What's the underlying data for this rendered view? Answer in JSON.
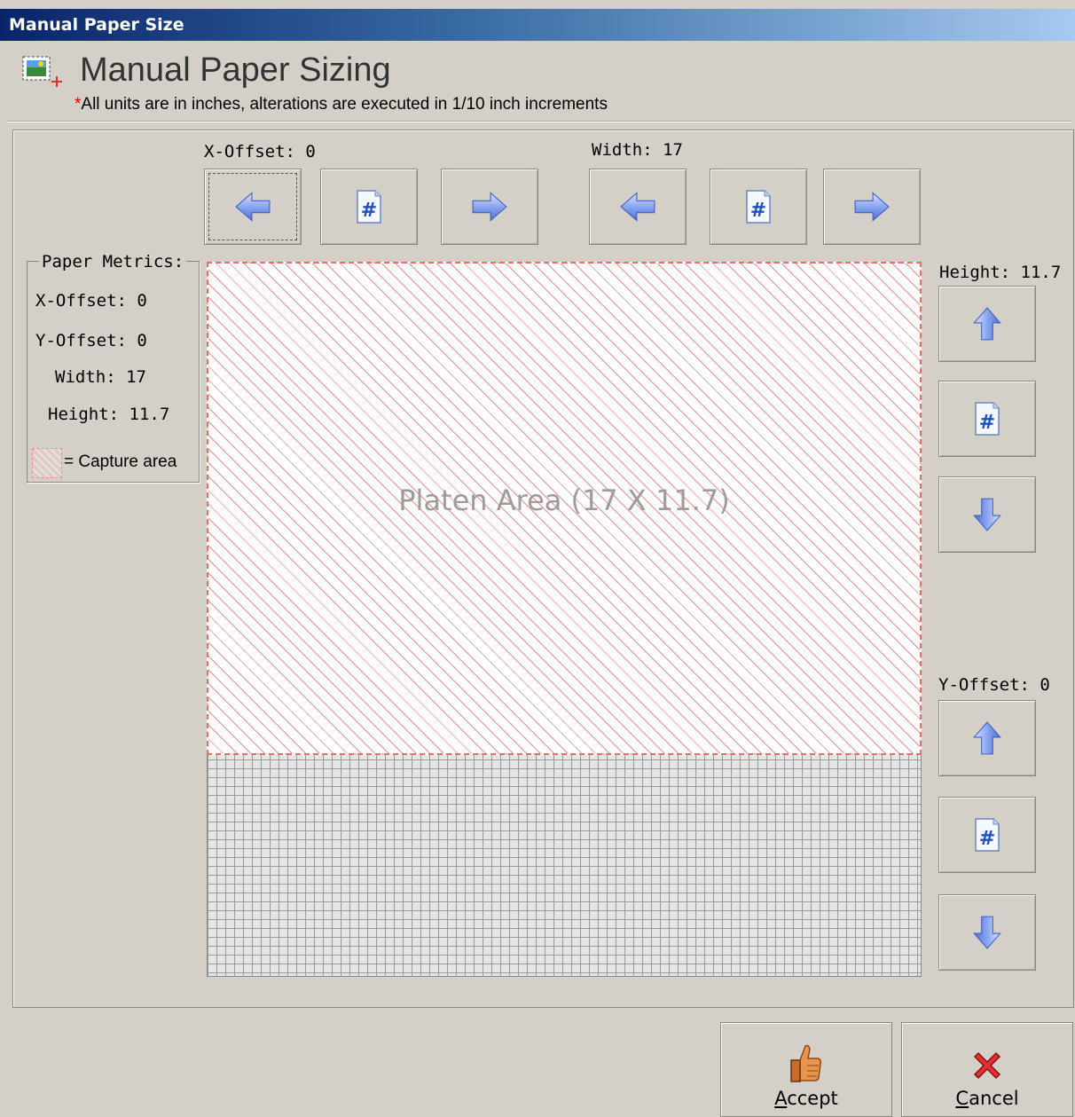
{
  "window": {
    "title": "Manual Paper Size"
  },
  "header": {
    "title": "Manual Paper Sizing",
    "note_mark": "*",
    "note": "All units are in inches, alterations are executed in 1/10 inch increments"
  },
  "x_offset": {
    "label": "X-Offset: 0"
  },
  "width": {
    "label": "Width: 17"
  },
  "height": {
    "label": "Height: 11.7"
  },
  "y_offset": {
    "label": "Y-Offset: 0"
  },
  "metrics": {
    "legend": "Paper Metrics:",
    "x_offset": "X-Offset: 0",
    "y_offset": "Y-Offset: 0",
    "width": "Width: 17",
    "height": "Height: 11.7",
    "capture_area": "= Capture area"
  },
  "platen": {
    "label": "Platen Area (17 X 11.7)"
  },
  "buttons": {
    "accept": {
      "mnemonic": "A",
      "rest": "ccept"
    },
    "cancel": {
      "mnemonic": "C",
      "rest": "ancel"
    }
  },
  "colors": {
    "capture_hatch": "#f08c8c",
    "title_start": "#0a246a",
    "arrow_blue": "#6f8ee6"
  }
}
